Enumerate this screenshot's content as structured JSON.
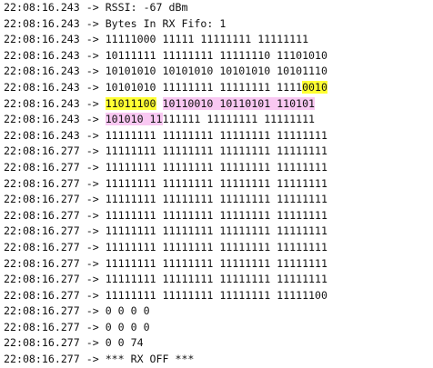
{
  "console": {
    "lines": [
      {
        "ts": "22:08:16.243",
        "sep": " -> ",
        "segs": [
          {
            "t": "RSSI: -67 dBm"
          }
        ]
      },
      {
        "ts": "22:08:16.243",
        "sep": " -> ",
        "segs": [
          {
            "t": "Bytes In RX Fifo: 1"
          }
        ]
      },
      {
        "ts": "22:08:16.243",
        "sep": " -> ",
        "segs": [
          {
            "t": "11111000 11111 11111111 11111111"
          }
        ]
      },
      {
        "ts": "22:08:16.243",
        "sep": " -> ",
        "segs": [
          {
            "t": "10111111 11111111 11111110 11101010"
          }
        ]
      },
      {
        "ts": "22:08:16.243",
        "sep": " -> ",
        "segs": [
          {
            "t": "10101010 10101010 10101010 10101110"
          }
        ]
      },
      {
        "ts": "22:08:16.243",
        "sep": " -> ",
        "segs": [
          {
            "t": "10101010 11111111 11111111 1111"
          },
          {
            "t": "0010",
            "hl": "yellow"
          }
        ]
      },
      {
        "ts": "22:08:16.243",
        "sep": " -> ",
        "segs": [
          {
            "t": "11011100",
            "hl": "yellow"
          },
          {
            "t": " "
          },
          {
            "t": "10110010 10110101 110101",
            "hl": "pink"
          }
        ]
      },
      {
        "ts": "22:08:16.243",
        "sep": " -> ",
        "segs": [
          {
            "t": "101010 11",
            "hl": "pink"
          },
          {
            "t": "111111 11111111 11111111"
          }
        ]
      },
      {
        "ts": "22:08:16.243",
        "sep": " -> ",
        "segs": [
          {
            "t": "11111111 11111111 11111111 11111111"
          }
        ]
      },
      {
        "ts": "22:08:16.277",
        "sep": " -> ",
        "segs": [
          {
            "t": "11111111 11111111 11111111 11111111"
          }
        ]
      },
      {
        "ts": "22:08:16.277",
        "sep": " -> ",
        "segs": [
          {
            "t": "11111111 11111111 11111111 11111111"
          }
        ]
      },
      {
        "ts": "22:08:16.277",
        "sep": " -> ",
        "segs": [
          {
            "t": "11111111 11111111 11111111 11111111"
          }
        ]
      },
      {
        "ts": "22:08:16.277",
        "sep": " -> ",
        "segs": [
          {
            "t": "11111111 11111111 11111111 11111111"
          }
        ]
      },
      {
        "ts": "22:08:16.277",
        "sep": " -> ",
        "segs": [
          {
            "t": "11111111 11111111 11111111 11111111"
          }
        ]
      },
      {
        "ts": "22:08:16.277",
        "sep": " -> ",
        "segs": [
          {
            "t": "11111111 11111111 11111111 11111111"
          }
        ]
      },
      {
        "ts": "22:08:16.277",
        "sep": " -> ",
        "segs": [
          {
            "t": "11111111 11111111 11111111 11111111"
          }
        ]
      },
      {
        "ts": "22:08:16.277",
        "sep": " -> ",
        "segs": [
          {
            "t": "11111111 11111111 11111111 11111111"
          }
        ]
      },
      {
        "ts": "22:08:16.277",
        "sep": " -> ",
        "segs": [
          {
            "t": "11111111 11111111 11111111 11111111"
          }
        ]
      },
      {
        "ts": "22:08:16.277",
        "sep": " -> ",
        "segs": [
          {
            "t": "11111111 11111111 11111111 11111100"
          }
        ]
      },
      {
        "ts": "22:08:16.277",
        "sep": " -> ",
        "segs": [
          {
            "t": "0 0 0 0"
          }
        ]
      },
      {
        "ts": "22:08:16.277",
        "sep": " -> ",
        "segs": [
          {
            "t": "0 0 0 0"
          }
        ]
      },
      {
        "ts": "22:08:16.277",
        "sep": " -> ",
        "segs": [
          {
            "t": "0 0 74"
          }
        ]
      },
      {
        "ts": "22:08:16.277",
        "sep": " -> ",
        "segs": [
          {
            "t": "*** RX OFF ***"
          }
        ]
      }
    ]
  },
  "colors": {
    "text": "#111111",
    "background": "#ffffff",
    "highlight_yellow": "#ffff33",
    "highlight_pink": "#f9c8f2"
  }
}
